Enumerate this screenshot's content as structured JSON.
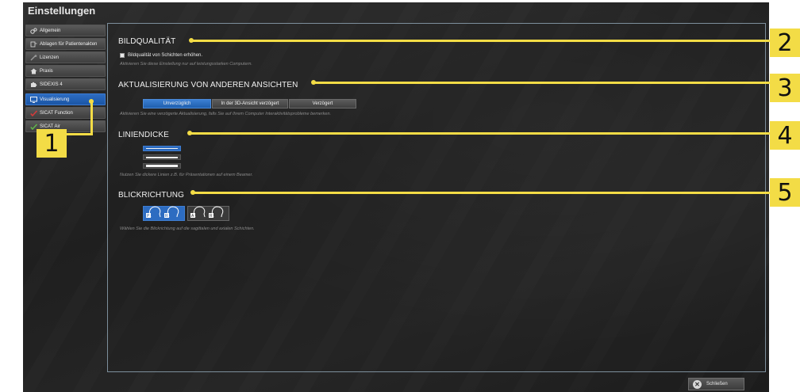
{
  "window": {
    "title": "Einstellungen"
  },
  "sidebar": {
    "items": [
      {
        "label": "Allgemein",
        "icon": "gears-icon"
      },
      {
        "label": "Ablagen für Patientenakten",
        "icon": "folder-icon"
      },
      {
        "label": "Lizenzen",
        "icon": "key-icon"
      },
      {
        "label": "Praxis",
        "icon": "house-icon"
      },
      {
        "label": "SIDEXIS 4",
        "icon": "puzzle-icon"
      },
      {
        "label": "Visualisierung",
        "icon": "monitor-icon",
        "active": true
      },
      {
        "label": "SICAT Function",
        "icon": "check-red-icon"
      },
      {
        "label": "SICAT Air",
        "icon": "check-green-icon"
      }
    ]
  },
  "sections": {
    "quality": {
      "title": "BILDQUALITÄT",
      "checkbox_label": "Bildqualität von Schichten erhöhen.",
      "hint": "Aktivieren Sie diese Einstellung nur auf leistungsstarken Computern."
    },
    "update": {
      "title": "AKTUALISIERUNG VON ANDEREN ANSICHTEN",
      "options": [
        "Unverzüglich",
        "In der 3D-Ansicht verzögert",
        "Verzögert"
      ],
      "selected": "Unverzüglich",
      "hint": "Aktivieren Sie eine verzögerte Aktualisierung, falls Sie auf Ihrem Computer Interaktivitätsprobleme bemerken."
    },
    "line": {
      "title": "LINIENDICKE",
      "hint": "Nutzen Sie dickere Linien z.B. für Präsentationen auf einem Beamer."
    },
    "view": {
      "title": "BLICKRICHTUNG",
      "options": [
        {
          "letters": [
            "P",
            "R"
          ]
        },
        {
          "letters": [
            "A",
            "R"
          ]
        }
      ],
      "hint": "Wählen Sie die Blickrichtung auf die sagittalen und axialen Schichten."
    }
  },
  "footer": {
    "close_label": "Schließen"
  },
  "callouts": [
    "1",
    "2",
    "3",
    "4",
    "5"
  ],
  "colors": {
    "accent": "#2d6cc1",
    "callout": "#f3dc46"
  }
}
